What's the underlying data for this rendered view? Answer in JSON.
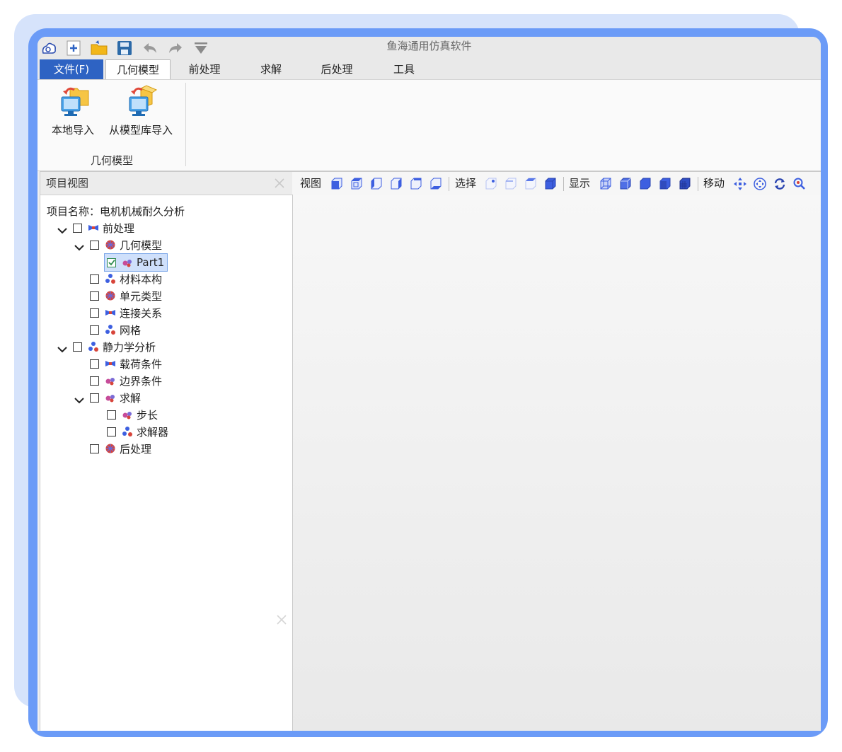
{
  "window": {
    "title": "鱼海通用仿真软件"
  },
  "quick_access": {
    "icons": [
      "app-logo-icon",
      "new-icon",
      "open-folder-icon",
      "save-icon",
      "undo-icon",
      "redo-icon",
      "dropdown-icon"
    ]
  },
  "tabs": [
    {
      "label": "文件(F)"
    },
    {
      "label": "几何模型"
    },
    {
      "label": "前处理"
    },
    {
      "label": "求解"
    },
    {
      "label": "后处理"
    },
    {
      "label": "工具"
    }
  ],
  "ribbon": {
    "group_label": "几何模型",
    "buttons": [
      {
        "label": "本地导入"
      },
      {
        "label": "从模型库导入"
      }
    ]
  },
  "project_panel": {
    "title": "项目视图",
    "project_name": "项目名称：电机机械耐久分析",
    "tree": [
      {
        "label": "前处理"
      },
      {
        "label": "几何模型"
      },
      {
        "label": "Part1",
        "checked": true
      },
      {
        "label": "材料本构"
      },
      {
        "label": "单元类型"
      },
      {
        "label": "连接关系"
      },
      {
        "label": "网格"
      },
      {
        "label": "静力学分析"
      },
      {
        "label": "载荷条件"
      },
      {
        "label": "边界条件"
      },
      {
        "label": "求解"
      },
      {
        "label": "步长"
      },
      {
        "label": "求解器"
      },
      {
        "label": "后处理"
      }
    ]
  },
  "viewport_toolbar": {
    "view_label": "视图",
    "select_label": "选择",
    "display_label": "显示",
    "move_label": "移动"
  },
  "colors": {
    "accent": "#2e63c3",
    "frame": "#6b9bf7",
    "icon_blue": "#3d5fe0"
  }
}
